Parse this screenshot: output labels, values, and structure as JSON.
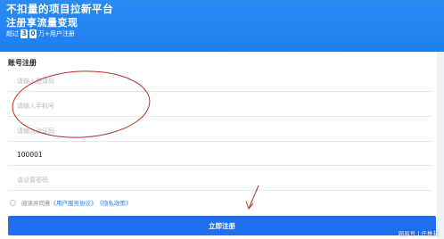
{
  "banner": {
    "title": "不扣量的项目拉新平台",
    "subtitle": "注册享流量变现",
    "count_prefix": "超过",
    "count_digits": [
      "3",
      "0"
    ],
    "count_suffix": "万+用户注册"
  },
  "form": {
    "title": "账号注册",
    "fields": [
      {
        "placeholder": "请输入邀请码",
        "value": ""
      },
      {
        "placeholder": "请输入手机号",
        "value": ""
      },
      {
        "placeholder": "请输入验证码",
        "value": ""
      },
      {
        "placeholder": "",
        "value": "100001"
      },
      {
        "placeholder": "请设置密码",
        "value": ""
      }
    ],
    "agree_prefix": "阅读并同意",
    "terms_link": "《用户服务协议》",
    "privacy_link": "《隐私政策》",
    "submit_label": "立即注册"
  },
  "watermark": "网易号 | 任推邦",
  "colors": {
    "banner": "#1f7ff0",
    "button": "#1f6ff0",
    "annotation": "#b9302a"
  }
}
